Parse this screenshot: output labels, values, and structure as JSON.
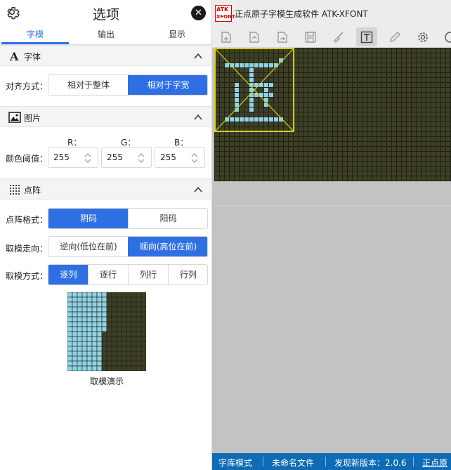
{
  "panel": {
    "title": "选项",
    "tabs": [
      "字模",
      "输出",
      "显示"
    ],
    "font_section": {
      "label": "字体",
      "align_label": "对齐方式：",
      "align_options": [
        "相对于整体",
        "相对于字宽"
      ],
      "align_selected": 1
    },
    "image_section": {
      "label": "图片",
      "threshold_label": "颜色阈值：",
      "channels": [
        {
          "name": "R：",
          "value": "255"
        },
        {
          "name": "G：",
          "value": "255"
        },
        {
          "name": "B：",
          "value": "255"
        }
      ]
    },
    "matrix_section": {
      "label": "点阵",
      "format_label": "点阵格式：",
      "format_options": [
        "阴码",
        "阳码"
      ],
      "format_selected": 0,
      "direction_label": "取模走向：",
      "direction_options": [
        "逆向(低位在前)",
        "顺向(高位在前)"
      ],
      "direction_selected": 1,
      "mode_label": "取模方式：",
      "mode_options": [
        "逐列",
        "逐行",
        "列行",
        "行列"
      ],
      "mode_selected": 0,
      "demo_caption": "取模演示"
    }
  },
  "app": {
    "logo_top": "ATK",
    "logo_bottom": "XFONT",
    "title": "正点原子字模生成软件 ATK-XFONT",
    "toolbar_icons": [
      "new-file-icon",
      "import-icon",
      "export-icon",
      "save-icon",
      "brush-icon",
      "text-icon",
      "pen-icon",
      "gear-icon",
      "settings-icon"
    ],
    "toolbar_active": "text-icon",
    "status": {
      "mode": "字库模式",
      "file": "未命名文件",
      "update": "发现新版本：2.0.6",
      "link": "正点原子"
    }
  },
  "colors": {
    "accent": "#2f6fe4",
    "pixel_on": "#8fd3e8",
    "pixel_off": "#3e3f27",
    "grid_line": "#20210f",
    "selection": "#d4d01e",
    "status_bar": "#0e6bb5"
  }
}
